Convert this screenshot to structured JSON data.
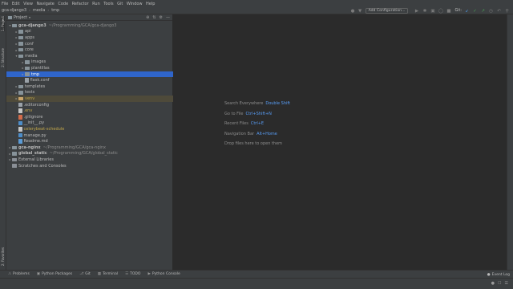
{
  "menubar": {
    "items": [
      "File",
      "Edit",
      "View",
      "Navigate",
      "Code",
      "Refactor",
      "Run",
      "Tools",
      "Git",
      "Window",
      "Help"
    ]
  },
  "navbar": {
    "breadcrumbs": [
      "gca-django3",
      "media",
      "tmp"
    ],
    "add_configuration": "Add Configuration...",
    "git_label": "Git:"
  },
  "side_tabs": {
    "project": "1: Project",
    "structure": "2: Structure",
    "favorites": "2: Favorites"
  },
  "project_panel": {
    "title": "Project",
    "rows": [
      {
        "label": "gca-django3",
        "path": "~/Programming/GCA/gca-django3",
        "kind": "folder",
        "bold": true,
        "arrow": "▾",
        "indent": 0
      },
      {
        "label": "api",
        "kind": "folder",
        "arrow": "▸",
        "indent": 1
      },
      {
        "label": "apps",
        "kind": "folder",
        "arrow": "▸",
        "indent": 1
      },
      {
        "label": "conf",
        "kind": "folder",
        "arrow": "▸",
        "indent": 1
      },
      {
        "label": "core",
        "kind": "folder",
        "arrow": "▸",
        "indent": 1
      },
      {
        "label": "media",
        "kind": "folder",
        "arrow": "▾",
        "indent": 1
      },
      {
        "label": "images",
        "kind": "folder",
        "arrow": "▸",
        "indent": 2
      },
      {
        "label": "plantillas",
        "kind": "folder",
        "arrow": "▸",
        "indent": 2
      },
      {
        "label": "tmp",
        "kind": "folder",
        "arrow": "▸",
        "indent": 2,
        "selected": true
      },
      {
        "label": "flask.conf",
        "kind": "cfg",
        "indent": 2
      },
      {
        "label": "templates",
        "kind": "folder",
        "arrow": "▸",
        "indent": 1
      },
      {
        "label": "tests",
        "kind": "folder",
        "arrow": "▸",
        "indent": 1
      },
      {
        "label": "venv",
        "kind": "special",
        "arrow": "▸",
        "indent": 1,
        "highlight": true,
        "color": "yellow"
      },
      {
        "label": ".editorconfig",
        "kind": "cfg",
        "indent": 1
      },
      {
        "label": ".env",
        "kind": "txt",
        "indent": 1,
        "color": "yellow"
      },
      {
        "label": ".gitignore",
        "kind": "git",
        "indent": 1
      },
      {
        "label": "__init__.py",
        "kind": "py",
        "indent": 1
      },
      {
        "label": "celerybeat-schedule",
        "kind": "txt",
        "indent": 1,
        "color": "yellow"
      },
      {
        "label": "manage.py",
        "kind": "py",
        "indent": 1
      },
      {
        "label": "Readme.md",
        "kind": "md",
        "indent": 1
      },
      {
        "label": "gca-nginx",
        "path": "~/Programming/GCA/gca-nginx",
        "kind": "folder",
        "bold": true,
        "arrow": "▸",
        "indent": 0
      },
      {
        "label": "global_static",
        "path": "~/Programming/GCA/global_static",
        "kind": "folder",
        "bold": true,
        "arrow": "▸",
        "indent": 0
      },
      {
        "label": "External Libraries",
        "kind": "lib",
        "arrow": "▸",
        "indent": 0
      },
      {
        "label": "Scratches and Consoles",
        "kind": "lib",
        "arrow": "",
        "indent": 0
      }
    ]
  },
  "editor_hints": [
    {
      "text": "Search Everywhere",
      "key": "Double Shift"
    },
    {
      "text": "Go to File",
      "key": "Ctrl+Shift+N"
    },
    {
      "text": "Recent Files",
      "key": "Ctrl+E"
    },
    {
      "text": "Navigation Bar",
      "key": "Alt+Home"
    },
    {
      "text": "Drop files here to open them",
      "key": ""
    }
  ],
  "bottom_tabs": [
    {
      "icon": "problems-icon",
      "label": "Problems"
    },
    {
      "icon": "python-packages-icon",
      "label": "Python Packages"
    },
    {
      "icon": "git-icon",
      "label": "Git"
    },
    {
      "icon": "terminal-icon",
      "label": "Terminal"
    },
    {
      "icon": "todo-icon",
      "label": "TODO"
    },
    {
      "icon": "python-console-icon",
      "label": "Python Console"
    }
  ],
  "event_log": "Event Log",
  "colors": {
    "selection": "#2f65ca",
    "accent_link": "#589df6",
    "panel_bg": "#3c3f41",
    "editor_bg": "#2b2b2b"
  }
}
